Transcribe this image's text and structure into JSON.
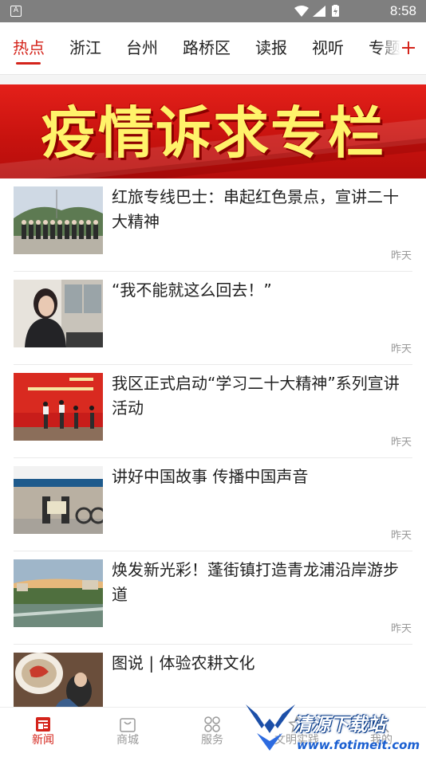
{
  "status_bar": {
    "time": "8:58",
    "notification_icon": "A"
  },
  "tabs": {
    "items": [
      {
        "label": "热点",
        "active": true
      },
      {
        "label": "浙江"
      },
      {
        "label": "台州"
      },
      {
        "label": "路桥区"
      },
      {
        "label": "读报"
      },
      {
        "label": "视听"
      },
      {
        "label": "专题"
      }
    ],
    "add_icon": "plus-icon"
  },
  "banner": {
    "title": "疫情诉求专栏"
  },
  "news": [
    {
      "title": "红旅专线巴士：串起红色景点，宣讲二十大精神",
      "time": "昨天"
    },
    {
      "title": "“我不能就这么回去！”",
      "time": "昨天"
    },
    {
      "title": "我区正式启动“学习二十大精神”系列宣讲活动",
      "time": "昨天"
    },
    {
      "title": "讲好中国故事  传播中国声音",
      "time": "昨天"
    },
    {
      "title": "焕发新光彩！蓬街镇打造青龙浦沿岸游步道",
      "time": "昨天"
    },
    {
      "title": "图说  |  体验农耕文化",
      "time": ""
    }
  ],
  "bottom_nav": {
    "items": [
      {
        "label": "新闻",
        "icon": "news-icon",
        "active": true
      },
      {
        "label": "商城",
        "icon": "shop-bag-icon"
      },
      {
        "label": "服务",
        "icon": "service-grid-icon"
      },
      {
        "label": "文明实践",
        "icon": "practice-icon"
      },
      {
        "label": "我的",
        "icon": "profile-icon"
      }
    ]
  },
  "watermark": {
    "name": "清源下载站",
    "url": "www.fotimeit.com"
  },
  "colors": {
    "accent": "#d4241b",
    "banner_text": "#fff36a",
    "banner_bg": "#d0170f"
  }
}
